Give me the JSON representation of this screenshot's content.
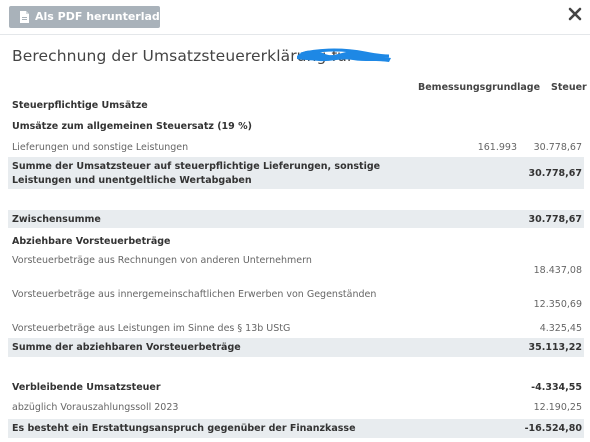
{
  "toolbar": {
    "pdf_button_label": "Als PDF herunterladen",
    "pdf_icon": "document-icon",
    "close_icon": "close-icon"
  },
  "page": {
    "title": "Berechnung der Umsatzsteuererklärung für"
  },
  "columns": {
    "basis": "Bemessungsgrundlage",
    "tax": "Steuer"
  },
  "rows": {
    "r1": {
      "label": "Steuerpflichtige Umsätze"
    },
    "r2": {
      "label": "Umsätze zum allgemeinen Steuersatz (19 %)"
    },
    "r3": {
      "label": "Lieferungen und sonstige Leistungen",
      "basis": "161.993",
      "tax": "30.778,67"
    },
    "r4": {
      "label_line1": "Summe der Umsatzsteuer auf steuerpflichtige Lieferungen, sonstige",
      "label_line2": "Leistungen und unentgeltliche Wertabgaben",
      "tax": "30.778,67"
    },
    "r5": {
      "label": "Zwischensumme",
      "tax": "30.778,67"
    },
    "r6": {
      "label": "Abziehbare Vorsteuerbeträge"
    },
    "r7": {
      "label": "Vorsteuerbeträge aus Rechnungen von anderen Unternehmern",
      "tax": "18.437,08"
    },
    "r8": {
      "label": "Vorsteuerbeträge aus innergemeinschaftlichen Erwerben von Gegenständen",
      "tax": "12.350,69"
    },
    "r9": {
      "label": "Vorsteuerbeträge aus Leistungen im Sinne des § 13b UStG",
      "tax": "4.325,45"
    },
    "r10": {
      "label": "Summe der abziehbaren Vorsteuerbeträge",
      "tax": "35.113,22"
    },
    "r11": {
      "label": "Verbleibende Umsatzsteuer",
      "tax": "-4.334,55"
    },
    "r12": {
      "label": "abzüglich Vorauszahlungssoll 2023",
      "tax": "12.190,25"
    },
    "r13": {
      "label": "Es besteht ein Erstattungsanspruch gegenüber der Finanzkasse",
      "tax": "-16.524,80"
    }
  },
  "colors": {
    "button_bg": "#a9b2ba",
    "row_shade": "#e8ecef",
    "redaction": "#1e88e5"
  }
}
